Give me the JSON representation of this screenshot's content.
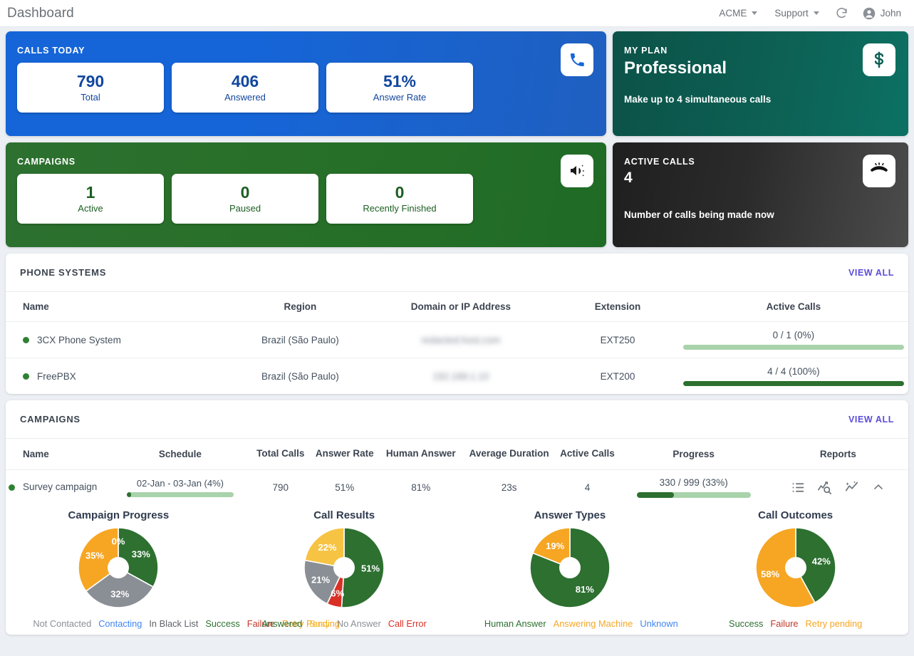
{
  "header": {
    "title": "Dashboard",
    "account": "ACME",
    "support": "Support",
    "refresh_icon": "refresh-icon",
    "user": "John"
  },
  "cards": {
    "calls_today": {
      "label": "CALLS TODAY",
      "icon": "phone-icon",
      "accent": "#1565d8",
      "stats": [
        {
          "value": "790",
          "label": "Total"
        },
        {
          "value": "406",
          "label": "Answered"
        },
        {
          "value": "51%",
          "label": "Answer Rate"
        }
      ]
    },
    "my_plan": {
      "label": "MY PLAN",
      "icon": "dollar-icon",
      "accent": "#0d6054",
      "name": "Professional",
      "description": "Make up to 4 simultaneous calls"
    },
    "campaigns": {
      "label": "CAMPAIGNS",
      "icon": "megaphone-icon",
      "accent": "#2d7030",
      "stats": [
        {
          "value": "1",
          "label": "Active"
        },
        {
          "value": "0",
          "label": "Paused"
        },
        {
          "value": "0",
          "label": "Recently Finished"
        }
      ]
    },
    "active_calls": {
      "label": "ACTIVE CALLS",
      "icon": "missed-call-icon",
      "accent": "#2b2b2b",
      "value": "4",
      "description": "Number of calls being made now"
    }
  },
  "phone_systems": {
    "title": "PHONE SYSTEMS",
    "view_all": "VIEW ALL",
    "columns": [
      "Name",
      "Region",
      "Domain or IP Address",
      "Extension",
      "Active Calls"
    ],
    "rows": [
      {
        "status": "online",
        "name": "3CX Phone System",
        "region": "Brazil (São Paulo)",
        "address": "redacted.host.com",
        "extension": "EXT250",
        "active_calls_text": "0 / 1 (0%)",
        "active_calls_pct": 0
      },
      {
        "status": "online",
        "name": "FreePBX",
        "region": "Brazil (São Paulo)",
        "address": "192.168.1.10",
        "extension": "EXT200",
        "active_calls_text": "4 / 4 (100%)",
        "active_calls_pct": 100
      }
    ]
  },
  "campaigns_panel": {
    "title": "CAMPAIGNS",
    "view_all": "VIEW ALL",
    "columns": [
      "Name",
      "Schedule",
      "Total Calls",
      "Answer Rate",
      "Human Answer",
      "Average Duration",
      "Active Calls",
      "Progress",
      "Reports"
    ],
    "rows": [
      {
        "status": "running",
        "name": "Survey campaign",
        "schedule_text": "02-Jan - 03-Jan (4%)",
        "schedule_pct": 4,
        "total_calls": "790",
        "answer_rate": "51%",
        "human_answer": "81%",
        "average_duration": "23s",
        "active_calls": "4",
        "progress_text": "330 / 999 (33%)",
        "progress_pct": 33,
        "report_icons": [
          "call-log-icon",
          "chart-search-icon",
          "chart-insights-icon",
          "chevron-up-icon"
        ]
      }
    ]
  },
  "chart_data": [
    {
      "type": "pie",
      "title": "Campaign Progress",
      "labels": [
        "Success",
        "In Black List",
        "Retry Pending",
        "Failure"
      ],
      "legend": [
        "Not Contacted",
        "Contacting",
        "In Black List",
        "Success",
        "Failure",
        "Retry Pending"
      ],
      "legend_colors": [
        "#8a8f96",
        "#4285f4",
        "#5f6368",
        "#2d7030",
        "#c0392b",
        "#f6a623"
      ],
      "values": [
        33,
        32,
        35,
        0
      ],
      "display_values": [
        "33%",
        "32%",
        "35%",
        "0%"
      ],
      "colors": [
        "#2d7030",
        "#8a8f96",
        "#f6a623",
        "#8a8f96"
      ],
      "legend_position": "bottom"
    },
    {
      "type": "pie",
      "title": "Call Results",
      "labels": [
        "Answered",
        "Call Error",
        "No Answer",
        "Busy"
      ],
      "legend": [
        "Answered",
        "Busy",
        "No Answer",
        "Call Error"
      ],
      "legend_colors": [
        "#2d7030",
        "#f6c343",
        "#8a8f96",
        "#d93025"
      ],
      "values": [
        51,
        6,
        21,
        22
      ],
      "display_values": [
        "51%",
        "6%",
        "21%",
        "22%"
      ],
      "colors": [
        "#2d7030",
        "#d93025",
        "#8a8f96",
        "#f6c343"
      ],
      "legend_position": "bottom"
    },
    {
      "type": "pie",
      "title": "Answer Types",
      "labels": [
        "Human Answer",
        "Answering Machine"
      ],
      "legend": [
        "Human Answer",
        "Answering Machine",
        "Unknown"
      ],
      "legend_colors": [
        "#2d7030",
        "#f6a623",
        "#4285f4"
      ],
      "values": [
        81,
        19
      ],
      "display_values": [
        "81%",
        "19%"
      ],
      "colors": [
        "#2d7030",
        "#f6a623"
      ],
      "legend_position": "bottom"
    },
    {
      "type": "pie",
      "title": "Call Outcomes",
      "labels": [
        "Success",
        "Retry pending"
      ],
      "legend": [
        "Success",
        "Failure",
        "Retry pending"
      ],
      "legend_colors": [
        "#2d7030",
        "#c0392b",
        "#f6a623"
      ],
      "values": [
        42,
        58
      ],
      "display_values": [
        "42%",
        "58%"
      ],
      "colors": [
        "#2d7030",
        "#f6a623"
      ],
      "legend_position": "bottom"
    }
  ]
}
